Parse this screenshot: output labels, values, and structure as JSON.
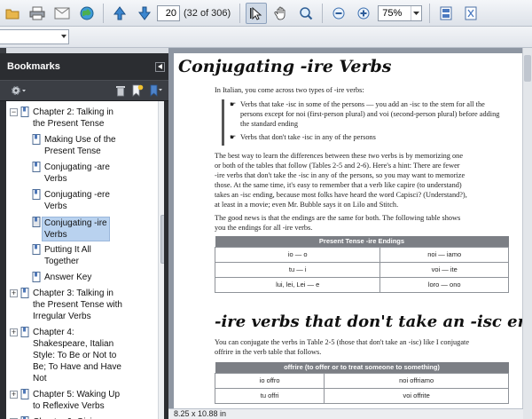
{
  "toolbar": {
    "page_number": "20",
    "page_count": "(32 of 306)",
    "zoom": "75%"
  },
  "colors": {
    "panel_bg": "#2b2d31",
    "selection": "#b9d2ef",
    "table_header": "#7c7f85",
    "doc_background": "#8e96a2"
  },
  "bookmarks": {
    "title": "Bookmarks",
    "items": [
      {
        "label": "Chapter 2: Talking in the Present Tense",
        "lines": [
          "Chapter 2: Talking in",
          "the Present Tense"
        ]
      },
      {
        "label": "Making Use of the Present Tense",
        "lines": [
          "Making Use of the",
          "Present Tense"
        ]
      },
      {
        "label": "Conjugating -are Verbs",
        "lines": [
          "Conjugating -are",
          "Verbs"
        ]
      },
      {
        "label": "Conjugating -ere Verbs",
        "lines": [
          "Conjugating -ere",
          "Verbs"
        ]
      },
      {
        "label": "Conjugating -ire Verbs",
        "lines": [
          "Conjugating -ire",
          "Verbs"
        ]
      },
      {
        "label": "Putting It All Together",
        "lines": [
          "Putting It All",
          "Together"
        ]
      },
      {
        "label": "Answer Key",
        "lines": [
          "Answer Key"
        ]
      },
      {
        "label": "Chapter 3: Talking in the Present Tense with Irregular Verbs",
        "lines": [
          "Chapter 3: Talking in",
          "the Present Tense with",
          "Irregular Verbs"
        ]
      },
      {
        "label": "Chapter 4: Shakespeare, Italian Style: To Be or Not to Be; To Have and Have Not",
        "lines": [
          "Chapter 4:",
          "Shakespeare, Italian",
          "Style: To Be or Not to",
          "Be; To Have and Have",
          "Not"
        ]
      },
      {
        "label": "Chapter 5: Waking Up to Reflexive Verbs",
        "lines": [
          "Chapter 5: Waking Up",
          "to Reflexive Verbs"
        ]
      },
      {
        "label": "Chapter 6: Giving a",
        "lines": [
          "Chapter 6: Giving a"
        ]
      }
    ]
  },
  "document": {
    "title": "Conjugating -ire Verbs",
    "intro": "In Italian, you come across two types of -ire verbs:",
    "bullets": [
      "Verbs that take -isc in some of the persons — you add an -isc to the stem for all the persons except for noi (first-person plural) and voi (second-person plural) before adding the standard ending",
      "Verbs that don't take -isc in any of the persons"
    ],
    "para1_lines": [
      "The best way to learn the differences between these two verbs is by memorizing one",
      "or both of the tables that follow (Tables 2-5 and 2-6). Here's a hint: There are fewer",
      "-ire verbs that don't take the -isc in any of the persons, so you may want to memorize",
      "those. At the same time, it's easy to remember that a verb like capire (to understand)",
      "takes an -isc ending, because most folks have heard the word Capisci? (Understand?),",
      "at least in a movie; even Mr. Bubble says it on Lilo and Stitch."
    ],
    "para2_lines": [
      "The good news is that the endings are the same for both. The following table shows",
      "you the endings for all -ire verbs."
    ],
    "table1": {
      "header": "Present Tense -ire Endings",
      "rows": [
        [
          "io — o",
          "noi — iamo"
        ],
        [
          "tu — i",
          "voi — ite"
        ],
        [
          "lui, lei, Lei — e",
          "loro — ono"
        ]
      ]
    },
    "section_title": "-ire verbs that don't take an -isc ending",
    "para3_lines": [
      "You can conjugate the verbs in Table 2-5 (those that don't take an -isc) like I conjugate",
      "offrire in the verb table that follows."
    ],
    "table2": {
      "header": "offrire (to offer or to treat someone to something)",
      "rows": [
        [
          "io offro",
          "noi offriamo"
        ],
        [
          "tu offri",
          "voi offrite"
        ]
      ]
    }
  },
  "status": {
    "page_size": "8.25 x 10.88 in"
  }
}
